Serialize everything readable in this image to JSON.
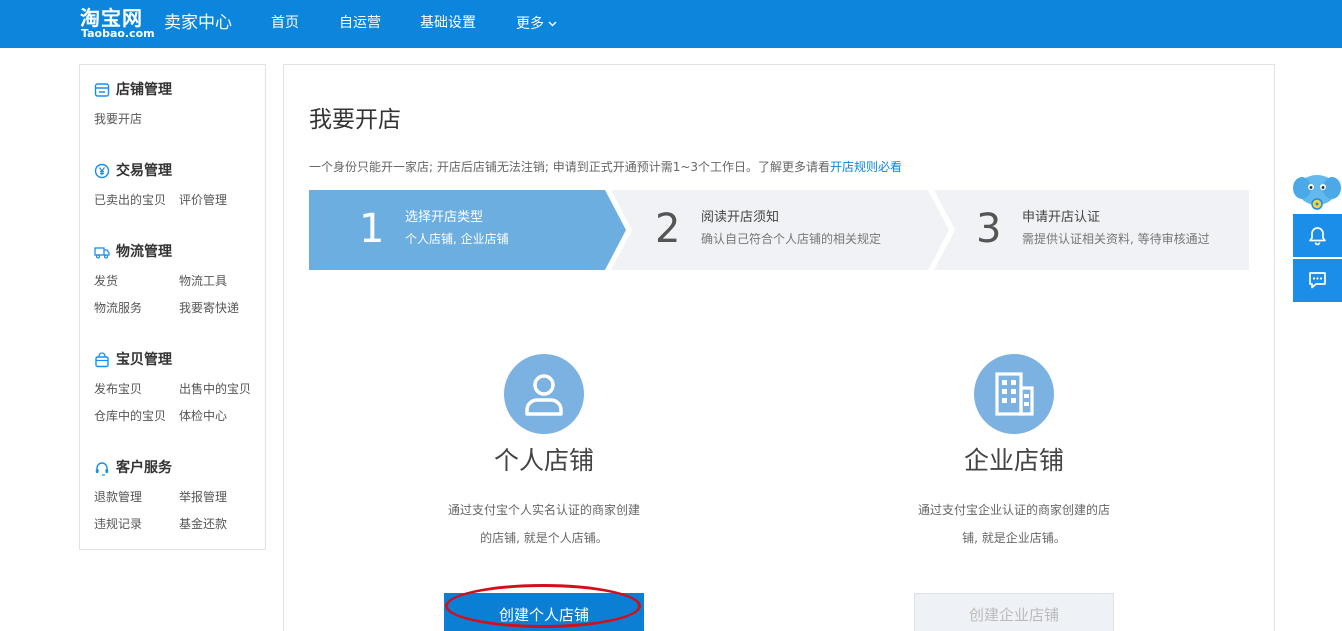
{
  "header": {
    "logo_text": "淘宝网",
    "logo_sub": "Taobao.com",
    "title": "卖家中心",
    "nav": [
      {
        "label": "首页"
      },
      {
        "label": "自运营"
      },
      {
        "label": "基础设置"
      },
      {
        "label": "更多"
      }
    ]
  },
  "sidebar": {
    "sections": [
      {
        "title": "店铺管理",
        "icon": "store-icon",
        "links": [
          "我要开店"
        ]
      },
      {
        "title": "交易管理",
        "icon": "yen-icon",
        "links": [
          "已卖出的宝贝",
          "评价管理"
        ]
      },
      {
        "title": "物流管理",
        "icon": "truck-icon",
        "links": [
          "发货",
          "物流工具",
          "物流服务",
          "我要寄快递"
        ]
      },
      {
        "title": "宝贝管理",
        "icon": "bag-icon",
        "links": [
          "发布宝贝",
          "出售中的宝贝",
          "仓库中的宝贝",
          "体检中心"
        ]
      },
      {
        "title": "客户服务",
        "icon": "headset-icon",
        "links": [
          "退款管理",
          "举报管理",
          "违规记录",
          "基金还款"
        ]
      }
    ]
  },
  "main": {
    "title": "我要开店",
    "notice_text": "一个身份只能开一家店; 开店后店铺无法注销; 申请到正式开通预计需1~3个工作日。了解更多请看",
    "notice_link": "开店规则必看",
    "steps": [
      {
        "num": "1",
        "title": "选择开店类型",
        "desc": "个人店铺, 企业店铺",
        "active": true
      },
      {
        "num": "2",
        "title": "阅读开店须知",
        "desc": "确认自己符合个人店铺的相关规定",
        "active": false
      },
      {
        "num": "3",
        "title": "申请开店认证",
        "desc": "需提供认证相关资料, 等待审核通过",
        "active": false
      }
    ],
    "personal": {
      "title": "个人店铺",
      "desc_line1": "通过支付宝个人实名认证的商家创建",
      "desc_line2": "的店铺, 就是个人店铺。",
      "button": "创建个人店铺"
    },
    "enterprise": {
      "title": "企业店铺",
      "desc_line1": "通过支付宝企业认证的商家创建的店",
      "desc_line2": "铺, 就是企业店铺。",
      "button": "创建企业店铺"
    }
  },
  "colors": {
    "header_bg": "#0b86dc",
    "step_active": "#6daee0",
    "step_inactive": "#f0f2f5",
    "icon_circle": "#7bb2e1",
    "primary_button": "#0a7fd4",
    "highlight_ellipse": "#d0111b"
  }
}
